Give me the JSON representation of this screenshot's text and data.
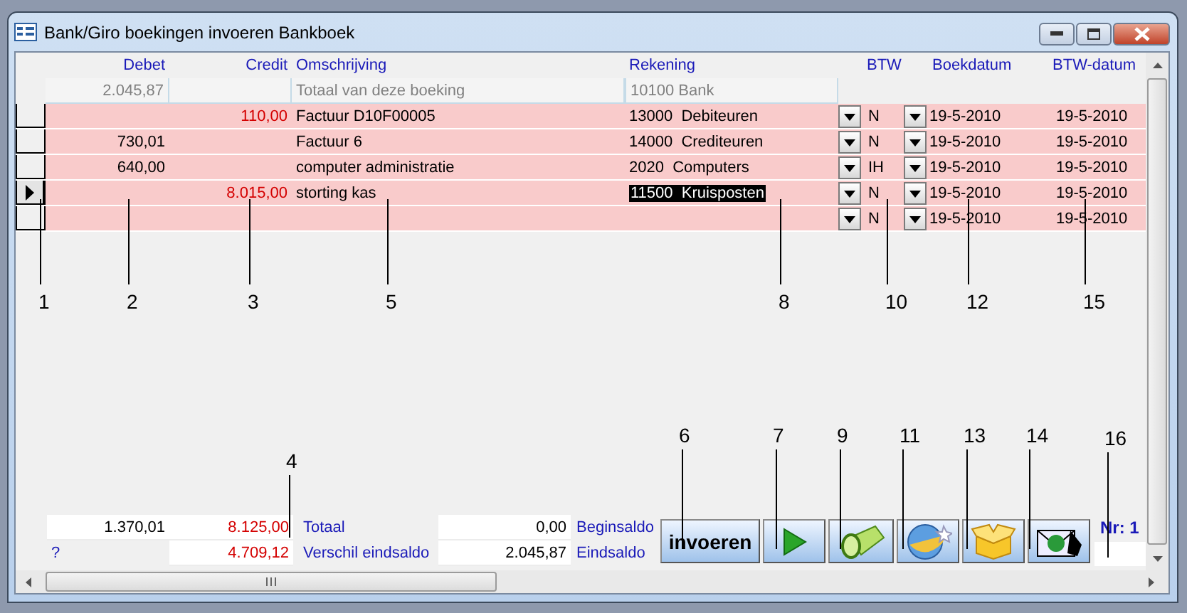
{
  "window": {
    "title": "Bank/Giro boekingen invoeren Bankboek"
  },
  "columns": [
    "Debet",
    "Credit",
    "Omschrijving",
    "Rekening",
    "BTW",
    "Boekdatum",
    "BTW-datum"
  ],
  "total_row": {
    "debet": "2.045,87",
    "omschrijving": "Totaal van deze boeking",
    "rekening": "10100 Bank"
  },
  "rows": [
    {
      "current": false,
      "credit": "110,00",
      "omschrijving": "Factuur D10F00005",
      "rekening": "13000  Debiteuren",
      "btw": "N",
      "boekdatum": "19-5-2010",
      "btw_datum": "19-5-2010"
    },
    {
      "current": false,
      "debet": "730,01",
      "omschrijving": "Factuur 6",
      "rekening": "14000  Crediteuren",
      "btw": "N",
      "boekdatum": "19-5-2010",
      "btw_datum": "19-5-2010"
    },
    {
      "current": false,
      "debet": "640,00",
      "omschrijving": "computer administratie",
      "rekening": "2020  Computers",
      "btw": "IH",
      "boekdatum": "19-5-2010",
      "btw_datum": "19-5-2010"
    },
    {
      "current": true,
      "credit": "8.015,00",
      "omschrijving": "storting kas",
      "rekening": "11500  Kruisposten",
      "btw": "N",
      "boekdatum": "19-5-2010",
      "btw_datum": "19-5-2010"
    },
    {
      "current": false,
      "btw": "N",
      "boekdatum": "19-5-2010",
      "btw_datum": "19-5-2010"
    }
  ],
  "totals": {
    "debet_total": "1.370,01",
    "credit_total": "8.125,00",
    "totaal_label": "Totaal",
    "beginsaldo": "0,00",
    "beginsaldo_label": "Beginsaldo",
    "verschil_flag": "?",
    "verschil": "4.709,12",
    "verschil_label": "Verschil eindsaldo",
    "eindsaldo": "2.045,87",
    "eindsaldo_label": "Eindsaldo"
  },
  "buttons": [
    {
      "kind": "text",
      "label": "invoeren"
    },
    {
      "kind": "play"
    },
    {
      "kind": "flashlight"
    },
    {
      "kind": "globe"
    },
    {
      "kind": "box"
    },
    {
      "kind": "mail"
    }
  ],
  "record_number": "Nr: 1",
  "top_callouts": [
    "1",
    "2",
    "3",
    "5",
    "8",
    "10",
    "12",
    "15"
  ],
  "bottom_callouts": [
    "4",
    "6",
    "7",
    "9",
    "11",
    "13",
    "14",
    "16"
  ]
}
